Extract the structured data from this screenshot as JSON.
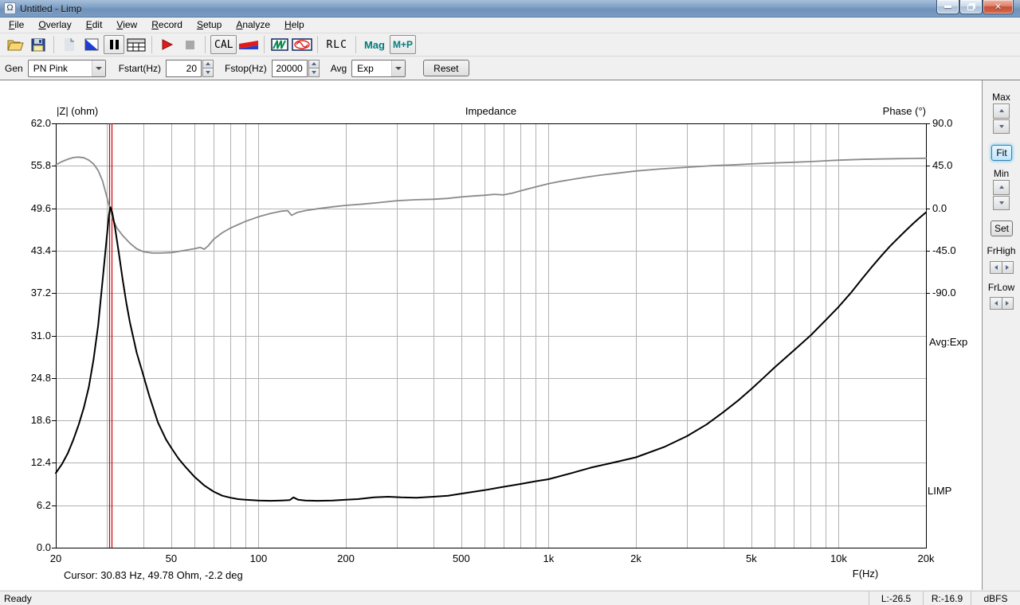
{
  "window": {
    "title": "Untitled - Limp",
    "icon_glyph": "Ω"
  },
  "menu": {
    "items": [
      "File",
      "Overlay",
      "Edit",
      "View",
      "Record",
      "Setup",
      "Analyze",
      "Help"
    ]
  },
  "toolbar": {
    "cal": "CAL",
    "rlc": "RLC",
    "mag": "Mag",
    "mp": "M+P",
    "icon_names": [
      "open-file-icon",
      "save-icon",
      "new-document-icon",
      "background-toggle-icon",
      "pause-icon",
      "data-table-icon",
      "play-record-icon",
      "stop-record-icon",
      "generator-flag-icon",
      "spectrum-icon",
      "sine-oscillator-icon"
    ]
  },
  "controls": {
    "gen_label": "Gen",
    "gen_value": "PN Pink",
    "fstart_label": "Fstart(Hz)",
    "fstart_value": "20",
    "fstop_label": "Fstop(Hz)",
    "fstop_value": "20000",
    "avg_label": "Avg",
    "avg_value": "Exp",
    "reset_label": "Reset"
  },
  "side_panel": {
    "max_label": "Max",
    "fit_label": "Fit",
    "min_label": "Min",
    "set_label": "Set",
    "frhigh_label": "FrHigh",
    "frlow_label": "FrLow"
  },
  "status": {
    "ready": "Ready",
    "cells": [
      "L:-26.5",
      "R:-16.9",
      "dBFS"
    ]
  },
  "chart_data": {
    "type": "line",
    "title": "Impedance",
    "ylabel_left": "|Z| (ohm)",
    "ylabel_right": "Phase (°)",
    "xlabel": "F(Hz)",
    "x_scale": "log",
    "x_range": [
      20,
      20000
    ],
    "ylim_left": [
      0,
      62
    ],
    "phase_axis_note": "90 deg at top, 45 deg per division, spans top 4 of 10 divisions",
    "grid_color": "#b2b2b2",
    "legend_right": "Avg:Exp",
    "watermark": "LIMP",
    "x_ticks": [
      {
        "f": 20,
        "label": "20"
      },
      {
        "f": 50,
        "label": "50"
      },
      {
        "f": 100,
        "label": "100"
      },
      {
        "f": 200,
        "label": "200"
      },
      {
        "f": 500,
        "label": "500"
      },
      {
        "f": 1000,
        "label": "1k"
      },
      {
        "f": 2000,
        "label": "2k"
      },
      {
        "f": 5000,
        "label": "5k"
      },
      {
        "f": 10000,
        "label": "10k"
      },
      {
        "f": 20000,
        "label": "20k"
      }
    ],
    "y_ticks_left": [
      {
        "v": 62,
        "label": "62.0"
      },
      {
        "v": 55.8,
        "label": "55.8"
      },
      {
        "v": 49.6,
        "label": "49.6"
      },
      {
        "v": 43.4,
        "label": "43.4"
      },
      {
        "v": 37.2,
        "label": "37.2"
      },
      {
        "v": 31.0,
        "label": "31.0"
      },
      {
        "v": 24.8,
        "label": "24.8"
      },
      {
        "v": 18.6,
        "label": "18.6"
      },
      {
        "v": 12.4,
        "label": "12.4"
      },
      {
        "v": 6.2,
        "label": "6.2"
      },
      {
        "v": 0,
        "label": "0.0"
      }
    ],
    "y_ticks_right": [
      {
        "deg": 90,
        "label": "90.0"
      },
      {
        "deg": 45,
        "label": "45.0"
      },
      {
        "deg": 0,
        "label": "0.0"
      },
      {
        "deg": -45,
        "label": "-45.0"
      },
      {
        "deg": -90,
        "label": "-90.0"
      }
    ],
    "x_gridlines": [
      30,
      40,
      50,
      60,
      70,
      80,
      90,
      100,
      200,
      300,
      400,
      500,
      600,
      700,
      800,
      900,
      1000,
      2000,
      3000,
      4000,
      5000,
      6000,
      7000,
      8000,
      9000,
      10000,
      20000
    ],
    "y_gridlines": [
      55.8,
      49.6,
      43.4,
      37.2,
      31.0,
      24.8,
      18.6,
      12.4,
      6.2
    ],
    "cursor": {
      "freq_hz": 30.83,
      "z_ohm": 49.78,
      "phase_deg": -2.2,
      "readout": "Cursor: 30.83 Hz, 49.78 Ohm, -2.2 deg",
      "color": "#cc0000"
    },
    "series": [
      {
        "name": "phase",
        "axis": "right",
        "color": "#8a8a8a",
        "width": 1.8,
        "points": [
          [
            20,
            46
          ],
          [
            21,
            49.5
          ],
          [
            22,
            52
          ],
          [
            23,
            53.8
          ],
          [
            24,
            54.3
          ],
          [
            25,
            53.5
          ],
          [
            26,
            51
          ],
          [
            27,
            47
          ],
          [
            28,
            40
          ],
          [
            29,
            29
          ],
          [
            30,
            12
          ],
          [
            30.83,
            -2.2
          ],
          [
            31.5,
            -12
          ],
          [
            32.5,
            -21
          ],
          [
            34,
            -29
          ],
          [
            36,
            -37
          ],
          [
            38,
            -43
          ],
          [
            40,
            -46
          ],
          [
            43,
            -47.5
          ],
          [
            46,
            -47.5
          ],
          [
            50,
            -47
          ],
          [
            55,
            -45
          ],
          [
            60,
            -43
          ],
          [
            63,
            -41.5
          ],
          [
            65,
            -43.5
          ],
          [
            67,
            -40
          ],
          [
            70,
            -33
          ],
          [
            75,
            -26
          ],
          [
            80,
            -21
          ],
          [
            90,
            -14
          ],
          [
            100,
            -9
          ],
          [
            110,
            -5.5
          ],
          [
            120,
            -3
          ],
          [
            126,
            -2.5
          ],
          [
            130,
            -7.5
          ],
          [
            136,
            -4.5
          ],
          [
            145,
            -2.5
          ],
          [
            160,
            -0.5
          ],
          [
            180,
            1.5
          ],
          [
            200,
            3
          ],
          [
            230,
            4.5
          ],
          [
            260,
            6
          ],
          [
            300,
            8
          ],
          [
            350,
            9
          ],
          [
            400,
            9.5
          ],
          [
            450,
            10.5
          ],
          [
            500,
            12
          ],
          [
            550,
            13
          ],
          [
            600,
            13.8
          ],
          [
            650,
            14.8
          ],
          [
            700,
            14.2
          ],
          [
            750,
            16
          ],
          [
            800,
            18.5
          ],
          [
            900,
            22.5
          ],
          [
            1000,
            26
          ],
          [
            1100,
            28.5
          ],
          [
            1200,
            30.5
          ],
          [
            1350,
            33
          ],
          [
            1500,
            35
          ],
          [
            1700,
            37
          ],
          [
            2000,
            39.5
          ],
          [
            2400,
            41.5
          ],
          [
            3000,
            43.5
          ],
          [
            3600,
            45
          ],
          [
            4300,
            46
          ],
          [
            5000,
            47
          ],
          [
            6000,
            48
          ],
          [
            7000,
            48.8
          ],
          [
            8000,
            49.5
          ],
          [
            9000,
            50.3
          ],
          [
            10000,
            51
          ],
          [
            12000,
            51.8
          ],
          [
            14000,
            52.3
          ],
          [
            16000,
            52.6
          ],
          [
            18000,
            52.8
          ],
          [
            20000,
            53
          ]
        ]
      },
      {
        "name": "impedance_magnitude",
        "axis": "left",
        "color": "#000000",
        "width": 2,
        "points": [
          [
            20,
            10.9
          ],
          [
            21,
            12.2
          ],
          [
            22,
            13.8
          ],
          [
            23,
            15.8
          ],
          [
            24,
            18.0
          ],
          [
            25,
            20.5
          ],
          [
            26,
            23.5
          ],
          [
            27,
            27.5
          ],
          [
            28,
            32.5
          ],
          [
            29,
            39.0
          ],
          [
            30,
            45.5
          ],
          [
            30.5,
            48.6
          ],
          [
            30.83,
            49.78
          ],
          [
            31.3,
            49.0
          ],
          [
            32,
            46.8
          ],
          [
            33,
            43.0
          ],
          [
            34,
            39.2
          ],
          [
            35,
            35.8
          ],
          [
            36,
            33.0
          ],
          [
            38,
            28.5
          ],
          [
            40,
            25.3
          ],
          [
            42,
            22.2
          ],
          [
            45,
            18.3
          ],
          [
            48,
            15.8
          ],
          [
            50,
            14.6
          ],
          [
            53,
            13.0
          ],
          [
            56,
            11.8
          ],
          [
            60,
            10.4
          ],
          [
            65,
            9.1
          ],
          [
            70,
            8.2
          ],
          [
            75,
            7.6
          ],
          [
            80,
            7.3
          ],
          [
            85,
            7.1
          ],
          [
            90,
            7.0
          ],
          [
            100,
            6.9
          ],
          [
            110,
            6.85
          ],
          [
            120,
            6.9
          ],
          [
            128,
            6.95
          ],
          [
            132,
            7.35
          ],
          [
            137,
            7.0
          ],
          [
            145,
            6.9
          ],
          [
            160,
            6.85
          ],
          [
            180,
            6.9
          ],
          [
            200,
            7.0
          ],
          [
            220,
            7.1
          ],
          [
            250,
            7.35
          ],
          [
            280,
            7.45
          ],
          [
            310,
            7.35
          ],
          [
            350,
            7.3
          ],
          [
            400,
            7.45
          ],
          [
            450,
            7.6
          ],
          [
            500,
            7.9
          ],
          [
            600,
            8.4
          ],
          [
            700,
            8.9
          ],
          [
            800,
            9.3
          ],
          [
            900,
            9.7
          ],
          [
            1000,
            10.0
          ],
          [
            1200,
            10.9
          ],
          [
            1400,
            11.7
          ],
          [
            1700,
            12.5
          ],
          [
            2000,
            13.2
          ],
          [
            2500,
            14.7
          ],
          [
            3000,
            16.3
          ],
          [
            3500,
            18.0
          ],
          [
            4000,
            19.8
          ],
          [
            4500,
            21.5
          ],
          [
            5000,
            23.2
          ],
          [
            5500,
            24.8
          ],
          [
            6000,
            26.3
          ],
          [
            7000,
            28.8
          ],
          [
            8000,
            31.0
          ],
          [
            9000,
            33.2
          ],
          [
            10000,
            35.2
          ],
          [
            11000,
            37.2
          ],
          [
            12000,
            39.2
          ],
          [
            13000,
            41.0
          ],
          [
            14000,
            42.6
          ],
          [
            15000,
            44.0
          ],
          [
            16000,
            45.2
          ],
          [
            17000,
            46.3
          ],
          [
            18000,
            47.3
          ],
          [
            19000,
            48.2
          ],
          [
            20000,
            49.0
          ]
        ]
      }
    ]
  }
}
